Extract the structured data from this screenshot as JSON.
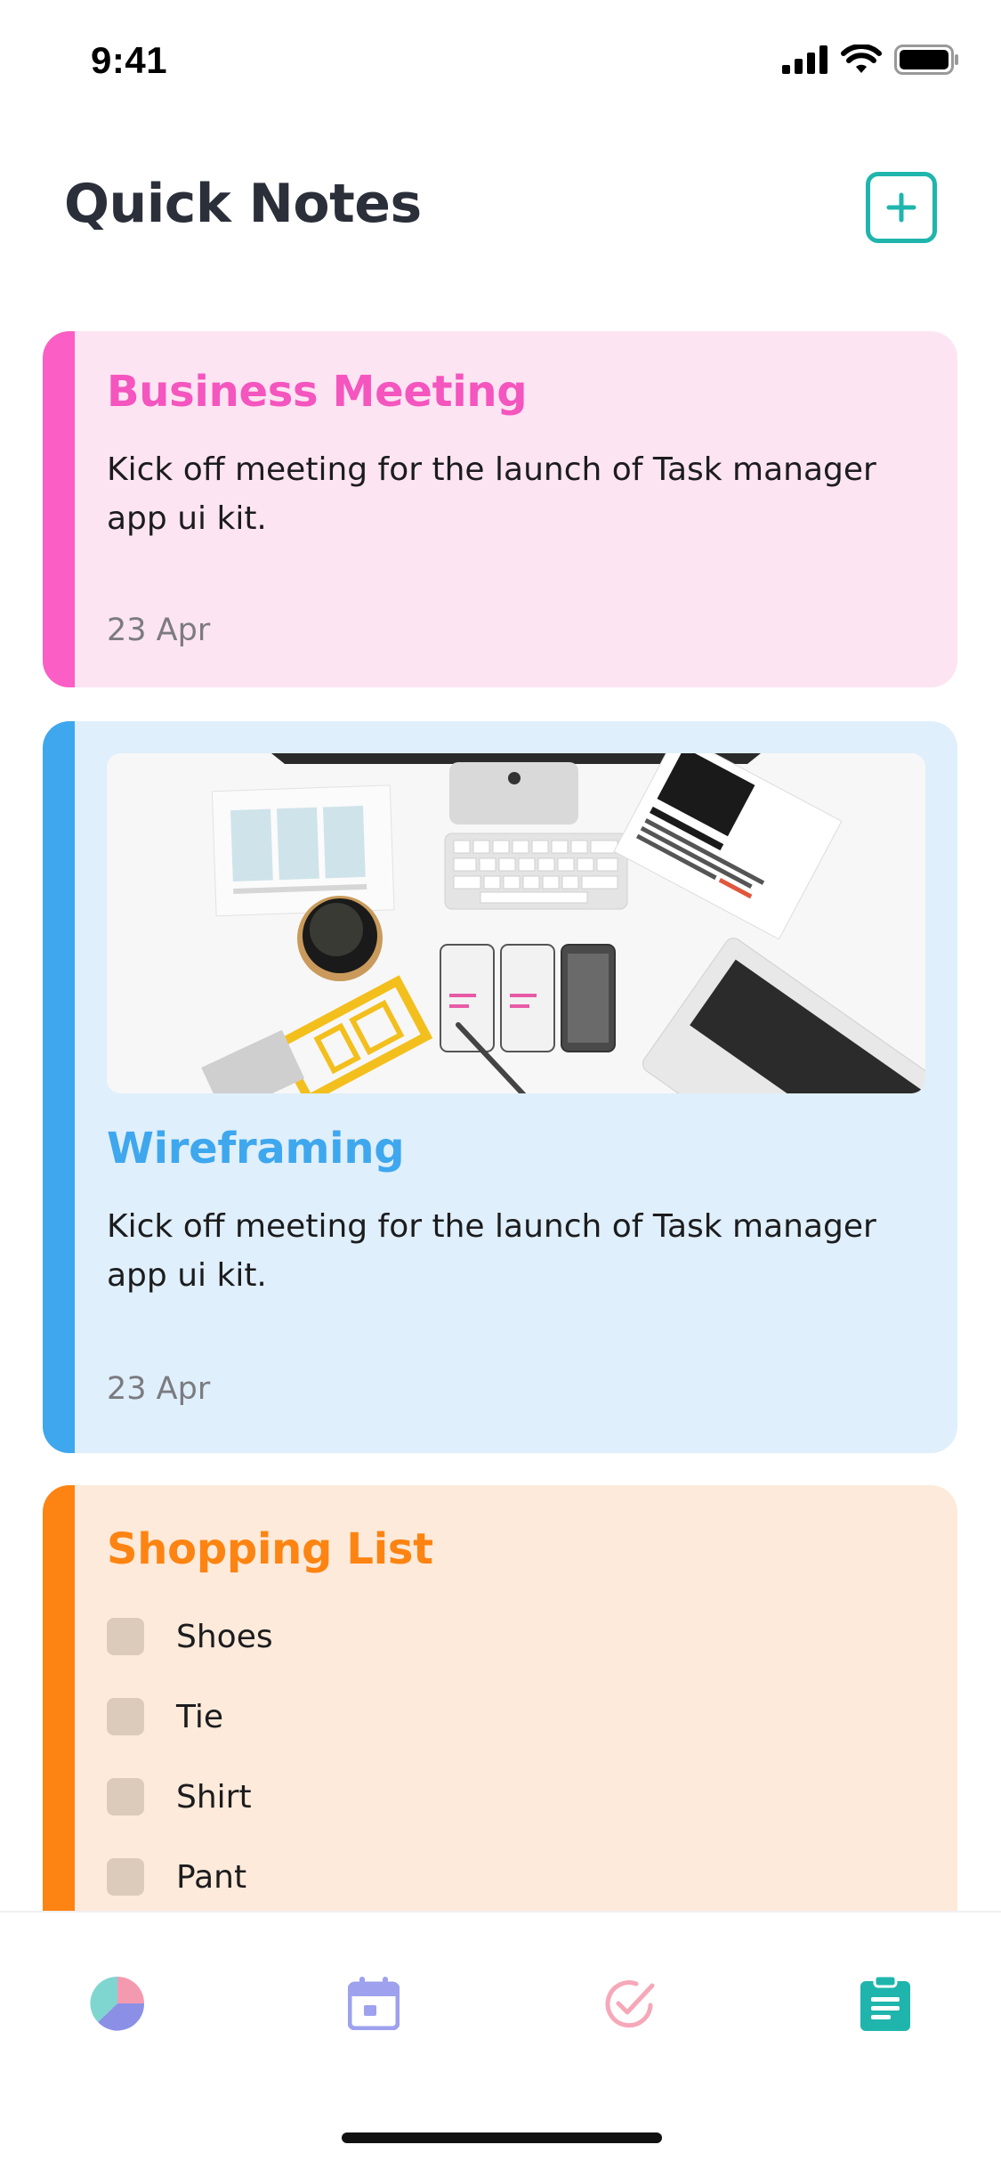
{
  "status_bar": {
    "time": "9:41"
  },
  "header": {
    "title": "Quick Notes",
    "add_icon": "plus-icon"
  },
  "notes": [
    {
      "title": "Business Meeting",
      "description": "Kick off meeting for the launch of Task manager app ui kit.",
      "date": "23 Apr",
      "accent": "#fb5ec4",
      "background": "#fde4f2"
    },
    {
      "title": "Wireframing",
      "description": "Kick off meeting for the launch of Task manager app ui kit.",
      "date": "23 Apr",
      "accent": "#3ea7ee",
      "background": "#dfeffb",
      "image": "desk-workspace-photo"
    },
    {
      "title": "Shopping List",
      "accent": "#fd8412",
      "background": "#fdeada",
      "items": [
        {
          "label": "Shoes",
          "checked": false
        },
        {
          "label": "Tie",
          "checked": false
        },
        {
          "label": "Shirt",
          "checked": false
        },
        {
          "label": "Pant",
          "checked": false
        }
      ]
    }
  ],
  "tab_bar": {
    "tabs": [
      {
        "icon": "pie-chart-icon",
        "active": false
      },
      {
        "icon": "calendar-icon",
        "active": false
      },
      {
        "icon": "check-circle-icon",
        "active": false
      },
      {
        "icon": "clipboard-icon",
        "active": true
      }
    ]
  },
  "colors": {
    "primary": "#1fb5ac",
    "title_text": "#2b2f3a"
  }
}
